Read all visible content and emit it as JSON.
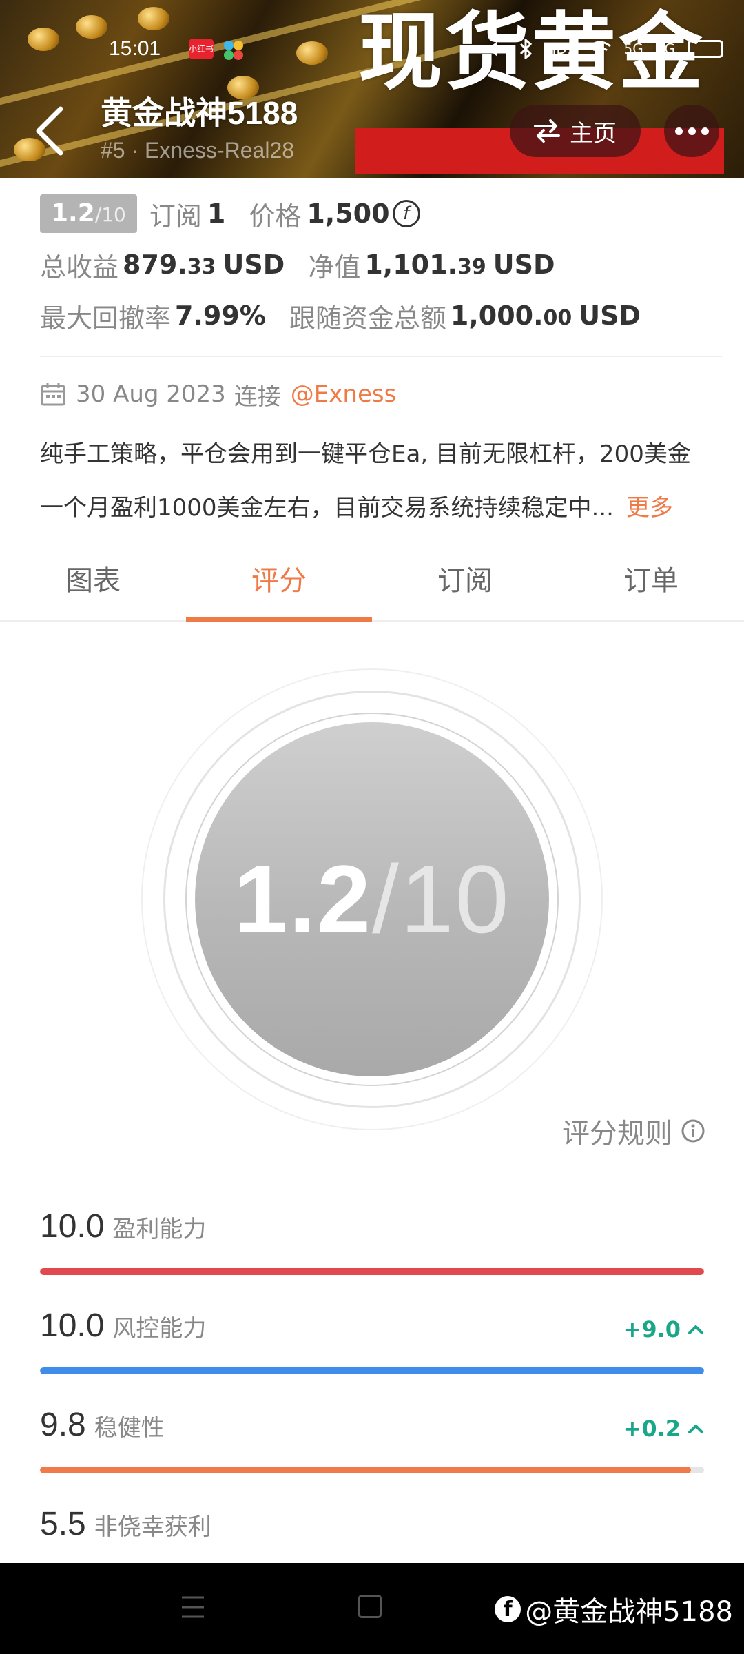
{
  "status_bar": {
    "time": "15:01",
    "app_badge": "小红书",
    "indicators": [
      "HD1",
      "5G",
      "4G"
    ]
  },
  "banner": {
    "text": "现货黄金"
  },
  "header": {
    "title": "黄金战神5188",
    "subtitle": "#5 · Exness-Real28",
    "home_label": "主页"
  },
  "stats": {
    "score_main": "1.2",
    "score_den": "/10",
    "subscribe_label": "订阅",
    "subscribe_value": "1",
    "price_label": "价格",
    "price_value": "1,500",
    "profit_label": "总收益",
    "profit_int": "879.",
    "profit_dec": "33",
    "profit_unit": "USD",
    "equity_label": "净值",
    "equity_int": "1,101.",
    "equity_dec": "39",
    "equity_unit": "USD",
    "drawdown_label": "最大回撤率",
    "drawdown_value": "7.99%",
    "follow_label": "跟随资金总额",
    "follow_int": "1,000.",
    "follow_dec": "00",
    "follow_unit": "USD"
  },
  "info": {
    "date": "30 Aug 2023",
    "connect_label": "连接",
    "broker": "@Exness",
    "description_line1": "纯手工策略，平仓会用到一键平仓Ea, 目前无限杠杆，200美金",
    "description_line2": "一个月盈利1000美金左右，目前交易系统持续稳定中...",
    "more_label": "更多"
  },
  "tabs": [
    {
      "label": "图表",
      "active": false
    },
    {
      "label": "评分",
      "active": true
    },
    {
      "label": "订阅",
      "active": false
    },
    {
      "label": "订单",
      "active": false
    }
  ],
  "big_score": {
    "value": "1.2",
    "denominator": "/10"
  },
  "rules_label": "评分规则",
  "metrics": [
    {
      "score": "10.0",
      "label": "盈利能力",
      "delta": "",
      "fill_fraction": 1.0,
      "color": "#e04a4f"
    },
    {
      "score": "10.0",
      "label": "风控能力",
      "delta": "+9.0",
      "fill_fraction": 1.0,
      "color": "#3f8de8"
    },
    {
      "score": "9.8",
      "label": "稳健性",
      "delta": "+0.2",
      "fill_fraction": 0.98,
      "color": "#f07a4a"
    },
    {
      "score": "5.5",
      "label": "非侥幸获利",
      "delta": "",
      "fill_fraction": 0.55,
      "color": "#f07a4a"
    }
  ],
  "watermark": "@黄金战神5188",
  "colors": {
    "accent": "#ef7a46",
    "positive": "#1aa789",
    "banner_red": "#d21d1d"
  }
}
